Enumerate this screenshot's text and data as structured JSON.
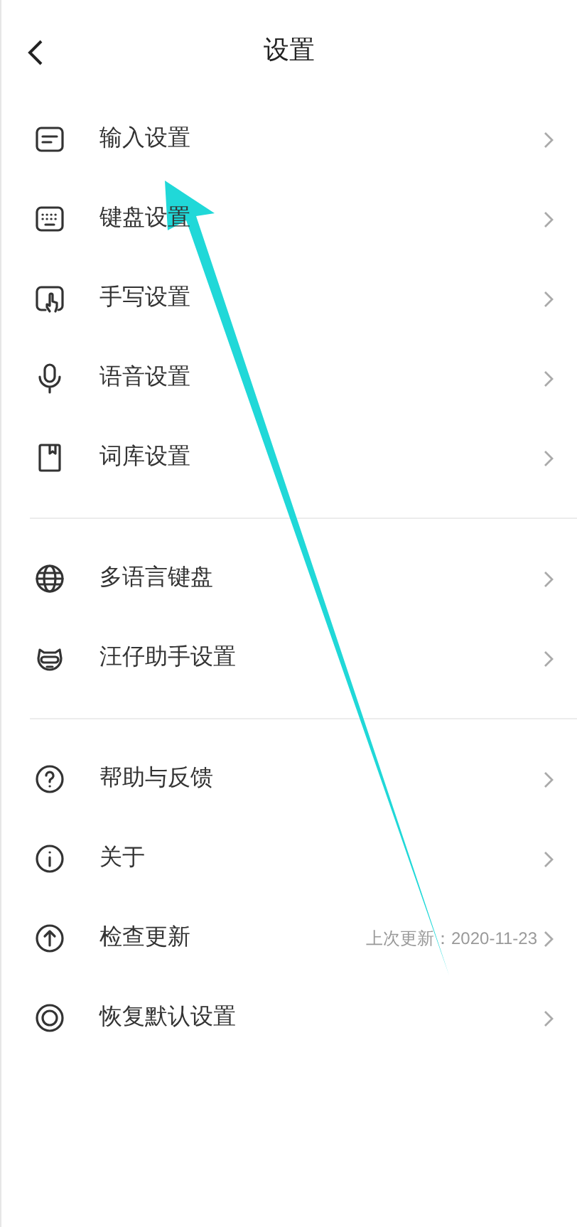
{
  "header": {
    "title": "设置"
  },
  "groups": [
    {
      "items": [
        {
          "label": "输入设置"
        },
        {
          "label": "键盘设置"
        },
        {
          "label": "手写设置"
        },
        {
          "label": "语音设置"
        },
        {
          "label": "词库设置"
        }
      ]
    },
    {
      "items": [
        {
          "label": "多语言键盘"
        },
        {
          "label": "汪仔助手设置"
        }
      ]
    },
    {
      "items": [
        {
          "label": "帮助与反馈"
        },
        {
          "label": "关于"
        },
        {
          "label": "检查更新",
          "detail": "上次更新：2020-11-23"
        },
        {
          "label": "恢复默认设置"
        }
      ]
    }
  ]
}
